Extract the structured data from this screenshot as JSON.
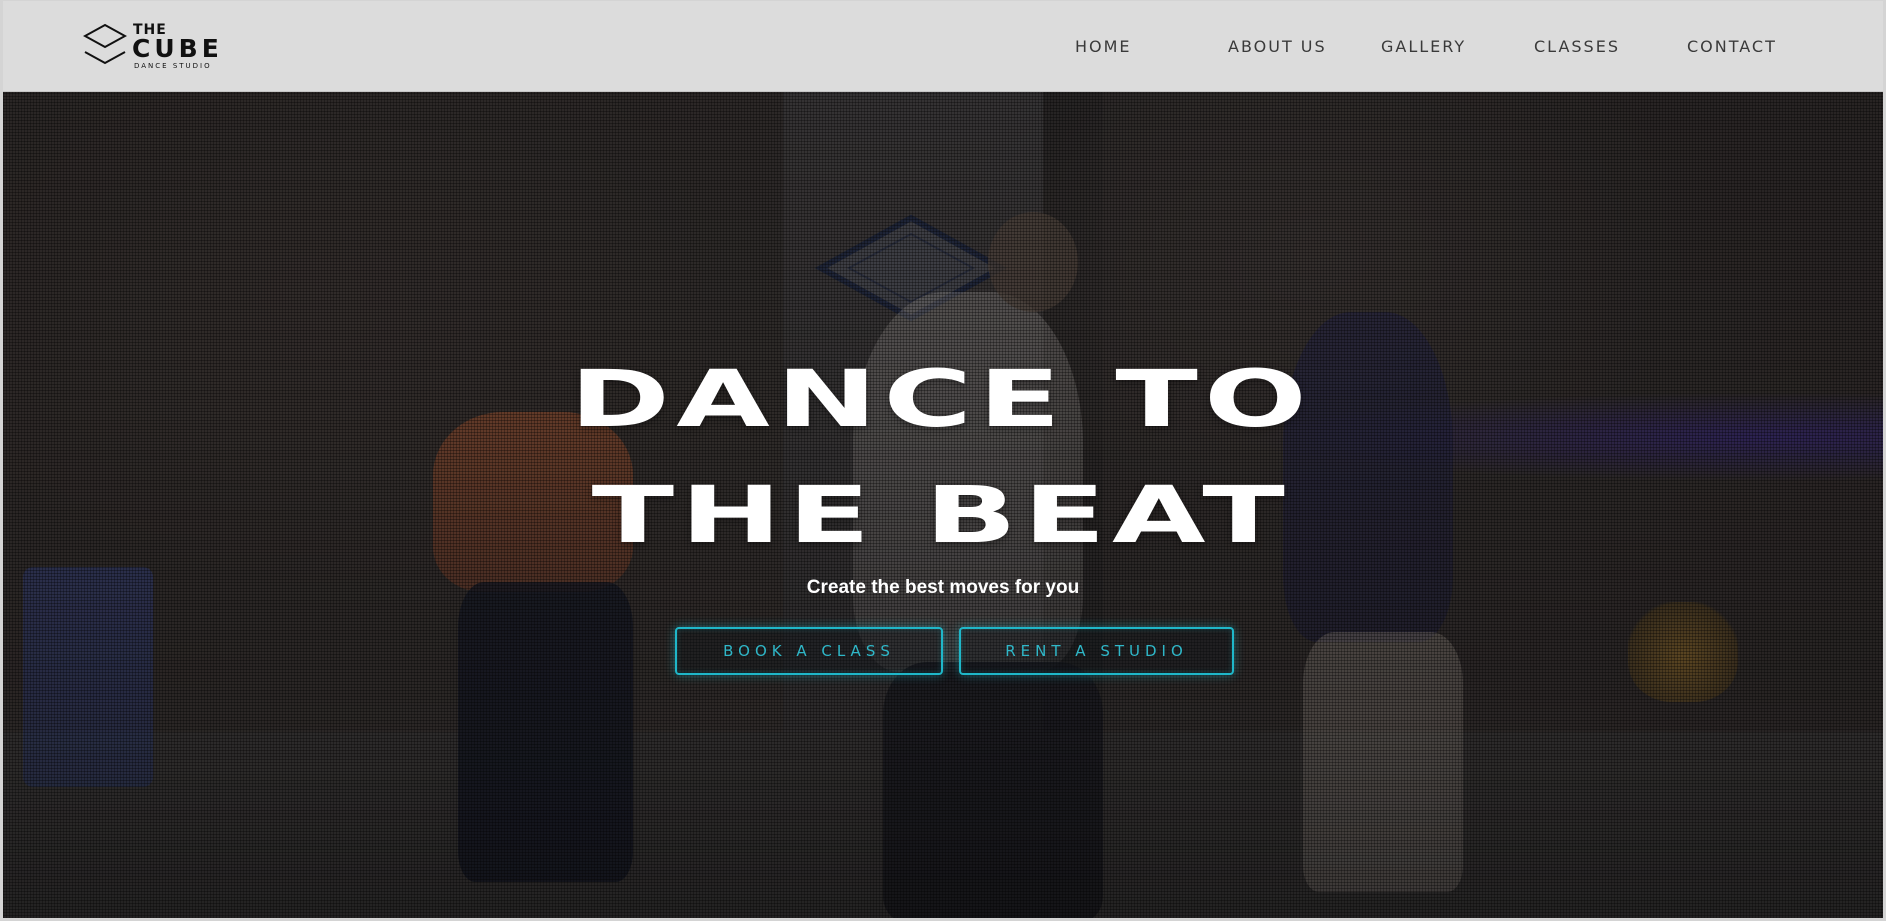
{
  "header": {
    "logo": {
      "the": "THE",
      "cube": "CUBE",
      "subtitle": "DANCE STUDIO"
    },
    "nav": [
      {
        "label": "HOME"
      },
      {
        "label": "ABOUT US"
      },
      {
        "label": "GALLERY"
      },
      {
        "label": "CLASSES"
      },
      {
        "label": "CONTACT"
      }
    ]
  },
  "hero": {
    "title_line1": "DANCE TO",
    "title_line2": "THE BEAT",
    "subtitle": "Create the best moves for you",
    "buttons": {
      "book": "BOOK A CLASS",
      "rent": "RENT A STUDIO"
    }
  },
  "colors": {
    "header_bg": "#dcdcdc",
    "accent": "#1fb7c9",
    "title": "#ffffff"
  }
}
